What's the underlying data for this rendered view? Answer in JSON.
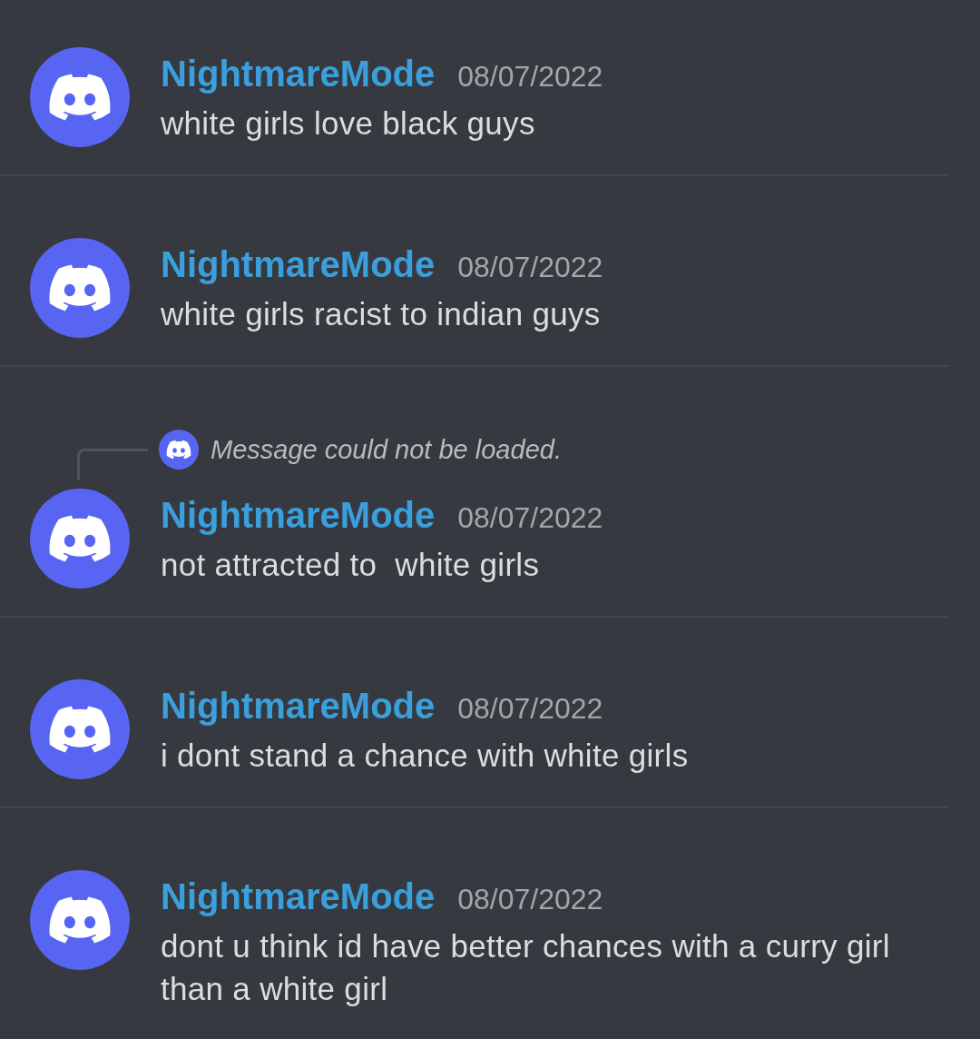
{
  "messages": [
    {
      "author": "NightmareMode",
      "timestamp": "08/07/2022",
      "text": "white girls love black guys"
    },
    {
      "author": "NightmareMode",
      "timestamp": "08/07/2022",
      "text": "white girls racist to indian guys"
    },
    {
      "reply": {
        "text": "Message could not be loaded."
      },
      "author": "NightmareMode",
      "timestamp": "08/07/2022",
      "text": "not attracted to  white girls"
    },
    {
      "author": "NightmareMode",
      "timestamp": "08/07/2022",
      "text": "i dont stand a chance with white girls"
    },
    {
      "author": "NightmareMode",
      "timestamp": "08/07/2022",
      "text": "dont u think id have better chances with a curry girl than a white girl"
    }
  ]
}
